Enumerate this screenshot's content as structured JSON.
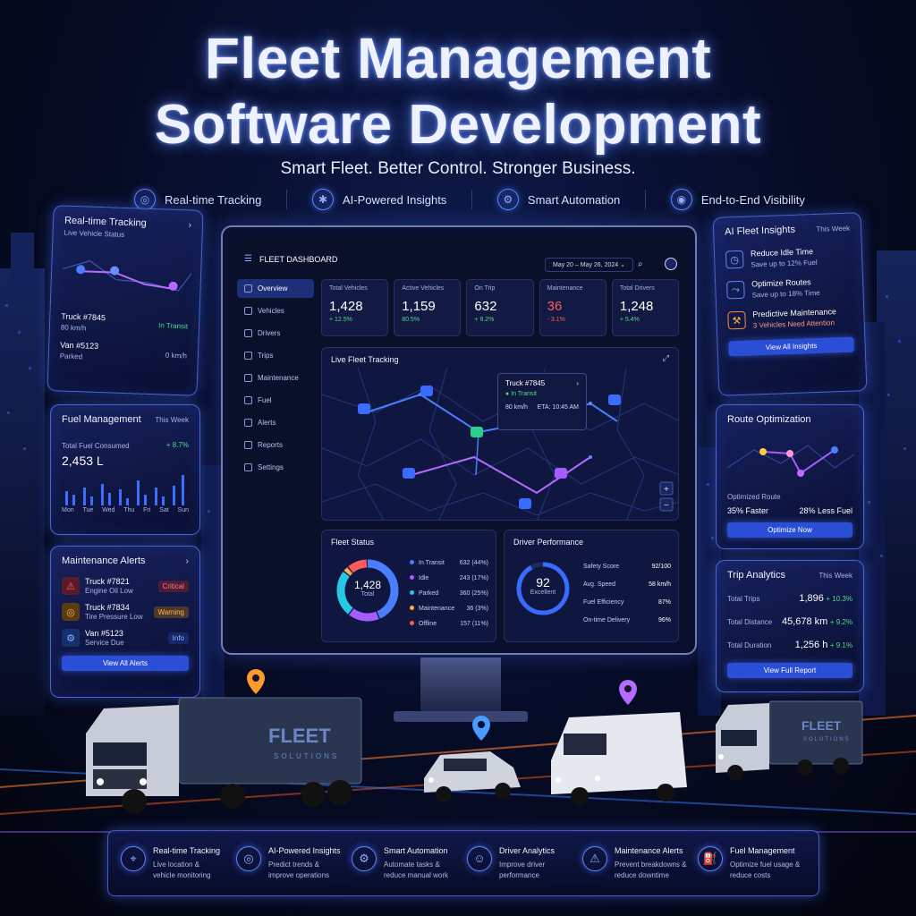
{
  "header": {
    "title_line1": "Fleet Management",
    "title_line2": "Software Development",
    "tagline": "Smart Fleet. Better Control. Stronger Business.",
    "pills": [
      {
        "label": "Real-time Tracking",
        "icon": "target-icon"
      },
      {
        "label": "AI-Powered Insights",
        "icon": "ai-chip-icon"
      },
      {
        "label": "Smart Automation",
        "icon": "gear-icon"
      },
      {
        "label": "End-to-End Visibility",
        "icon": "eye-icon"
      }
    ]
  },
  "left_cards": {
    "tracking": {
      "title": "Real-time Tracking",
      "subtitle": "Live Vehicle Status",
      "vehicles": [
        {
          "name": "Truck #7845",
          "speed": "80 km/h",
          "status": "In Transit"
        },
        {
          "name": "Van #5123",
          "speed": "Parked",
          "status": "0 km/h"
        }
      ]
    },
    "fuel": {
      "title": "Fuel Management",
      "period": "This Week",
      "label": "Total Fuel Consumed",
      "value": "2,453 L",
      "change": "+ 8.7%",
      "days": [
        "Mon",
        "Tue",
        "Wed",
        "Thu",
        "Fri",
        "Sat",
        "Sun"
      ]
    },
    "maintenance": {
      "title": "Maintenance Alerts",
      "alerts": [
        {
          "vehicle": "Truck #7821",
          "issue": "Engine Oil Low",
          "level": "Critical"
        },
        {
          "vehicle": "Truck #7834",
          "issue": "Tire Pressure Low",
          "level": "Warning"
        },
        {
          "vehicle": "Van #5123",
          "issue": "Service Due",
          "level": "Info"
        }
      ],
      "button": "View All Alerts"
    }
  },
  "right_cards": {
    "insights": {
      "title": "AI Fleet Insights",
      "period": "This Week",
      "items": [
        {
          "title": "Reduce Idle Time",
          "desc": "Save up to 12% Fuel"
        },
        {
          "title": "Optimize Routes",
          "desc": "Save up to 18% Time"
        },
        {
          "title": "Predictive Maintenance",
          "desc": "3 Vehicles Need Attention"
        }
      ],
      "button": "View All Insights"
    },
    "route": {
      "title": "Route Optimization",
      "label": "Optimized Route",
      "faster": "35% Faster",
      "fuel": "28% Less Fuel",
      "button": "Optimize Now"
    },
    "trip": {
      "title": "Trip Analytics",
      "period": "This Week",
      "rows": [
        {
          "label": "Total Trips",
          "value": "1,896",
          "change": "+ 10.3%"
        },
        {
          "label": "Total Distance",
          "value": "45,678 km",
          "change": "+ 9.2%"
        },
        {
          "label": "Total Duration",
          "value": "1,256 h",
          "change": "+ 9.1%"
        }
      ],
      "button": "View Full Report"
    }
  },
  "dashboard": {
    "title": "FLEET DASHBOARD",
    "date_range": "May 20 – May 26, 2024",
    "nav": [
      "Overview",
      "Vehicles",
      "Drivers",
      "Trips",
      "Maintenance",
      "Fuel",
      "Alerts",
      "Reports",
      "Settings"
    ],
    "stats": [
      {
        "label": "Total Vehicles",
        "value": "1,428",
        "change": "+ 12.5%"
      },
      {
        "label": "Active Vehicles",
        "value": "1,159",
        "change": "80.5%"
      },
      {
        "label": "On Trip",
        "value": "632",
        "change": "+ 8.2%"
      },
      {
        "label": "Maintenance",
        "value": "36",
        "change": "- 3.1%"
      },
      {
        "label": "Total Drivers",
        "value": "1,248",
        "change": "+ 5.4%"
      }
    ],
    "map": {
      "title": "Live Fleet Tracking",
      "popup_vehicle": "Truck #7845",
      "popup_status": "In Transit",
      "popup_speed": "80 km/h",
      "popup_eta": "ETA: 10:45 AM"
    },
    "fleet_status": {
      "title": "Fleet Status",
      "total": "1,428",
      "total_label": "Total",
      "items": [
        {
          "label": "In Transit",
          "value": "632 (44%)",
          "color": "#4a7dff",
          "share": 44
        },
        {
          "label": "Idle",
          "value": "243 (17%)",
          "color": "#a55cff",
          "share": 17
        },
        {
          "label": "Parked",
          "value": "360 (25%)",
          "color": "#29c7e6",
          "share": 25
        },
        {
          "label": "Maintenance",
          "value": "36 (3%)",
          "color": "#ffb13b",
          "share": 3
        },
        {
          "label": "Offline",
          "value": "157 (11%)",
          "color": "#ff5a5a",
          "share": 11
        }
      ]
    },
    "driver_perf": {
      "title": "Driver Performance",
      "score": "92",
      "score_label": "Excellent",
      "rows": [
        {
          "label": "Safety Score",
          "value": "92/100"
        },
        {
          "label": "Avg. Speed",
          "value": "58 km/h"
        },
        {
          "label": "Fuel Efficiency",
          "value": "87%"
        },
        {
          "label": "On-time Delivery",
          "value": "96%"
        }
      ]
    }
  },
  "vehicles": {
    "brand": "FLEET",
    "brand_sub": "SOLUTIONS"
  },
  "features": [
    {
      "title": "Real-time Tracking",
      "desc1": "Live location &",
      "desc2": "vehicle monitoring",
      "icon": "location-pin-icon"
    },
    {
      "title": "AI-Powered Insights",
      "desc1": "Predict trends &",
      "desc2": "improve operations",
      "icon": "ai-chip-icon"
    },
    {
      "title": "Smart Automation",
      "desc1": "Automate tasks &",
      "desc2": "reduce manual work",
      "icon": "automation-icon"
    },
    {
      "title": "Driver Analytics",
      "desc1": "Improve driver",
      "desc2": "performance",
      "icon": "user-icon"
    },
    {
      "title": "Maintenance Alerts",
      "desc1": "Prevent breakdowns &",
      "desc2": "reduce downtime",
      "icon": "alert-gear-icon"
    },
    {
      "title": "Fuel Management",
      "desc1": "Optimize fuel usage &",
      "desc2": "reduce costs",
      "icon": "fuel-icon"
    }
  ],
  "colors": {
    "accent": "#4a7dff",
    "glow": "#5f86ff",
    "background": "#060b24"
  }
}
